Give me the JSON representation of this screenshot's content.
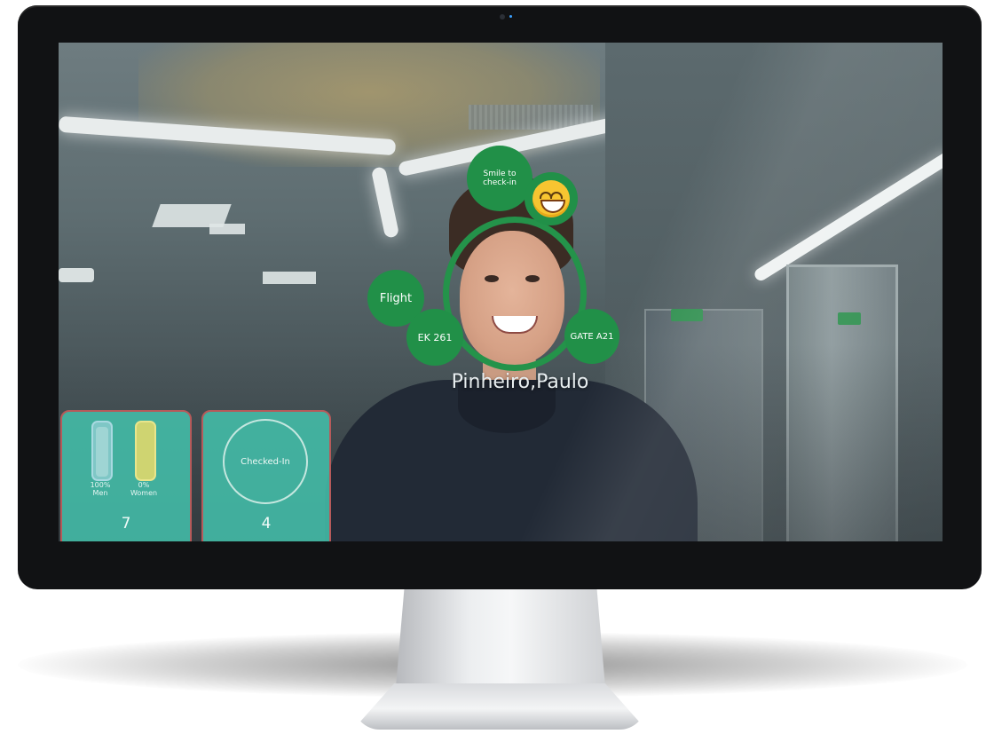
{
  "overlay": {
    "smile_prompt": "Smile to check-in",
    "smile_emoji": "grinning-face",
    "flight_label": "Flight",
    "flight_number": "EK 261",
    "gate": "GATE A21",
    "passenger_name": "Pinheiro,Paulo"
  },
  "stats": {
    "gender": {
      "men_percent_label": "100%",
      "men_label": "Men",
      "men_fraction": 1.0,
      "women_percent_label": "0%",
      "women_label": "Women",
      "women_fraction": 0.0,
      "count": "7"
    },
    "checkin": {
      "label": "Checked-In",
      "count": "4"
    }
  },
  "colors": {
    "overlay_green": "#219048",
    "card_teal": "#43beaa",
    "men_bar": "#7fc7c6",
    "women_bar": "#cfd471"
  }
}
